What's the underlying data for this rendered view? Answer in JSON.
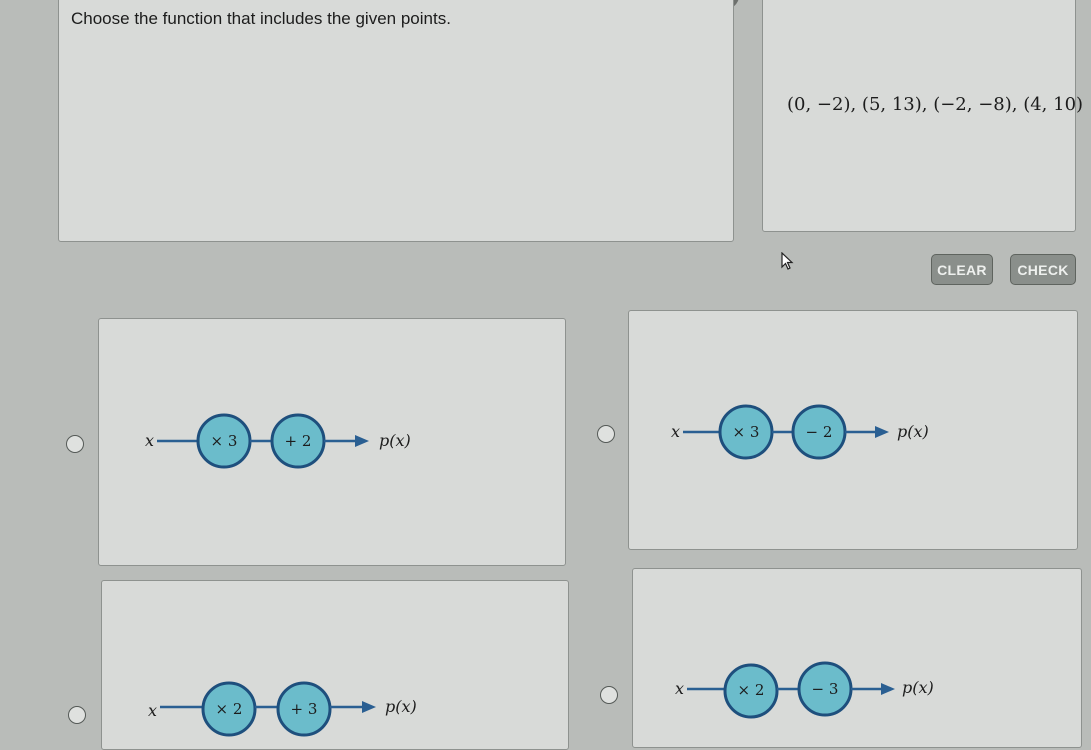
{
  "question": {
    "prompt": "Choose the function that includes the given points.",
    "points_text": "(0, −2), (5, 13), (−2, −8), (4, 10)"
  },
  "buttons": {
    "clear_label": "CLEAR",
    "check_label": "CHECK"
  },
  "colors": {
    "node_fill": "#6bbccb",
    "node_stroke": "#1e4f7d",
    "arrow": "#2a5f92"
  },
  "options": [
    {
      "input_label": "x",
      "step1": "× 3",
      "step2": "+ 2",
      "output_label": "p(x)",
      "selected": false
    },
    {
      "input_label": "x",
      "step1": "× 3",
      "step2": "− 2",
      "output_label": "p(x)",
      "selected": false
    },
    {
      "input_label": "x",
      "step1": "× 2",
      "step2": "+ 3",
      "output_label": "p(x)",
      "selected": false
    },
    {
      "input_label": "x",
      "step1": "× 2",
      "step2": "− 3",
      "output_label": "p(x)",
      "selected": false
    }
  ]
}
